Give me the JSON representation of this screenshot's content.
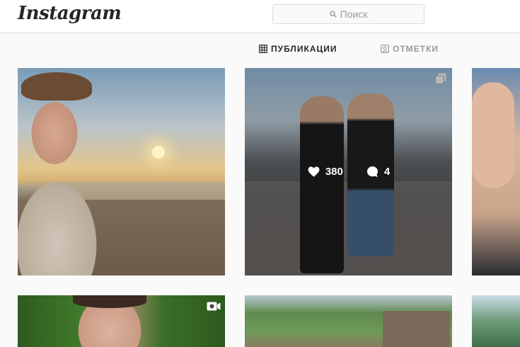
{
  "header": {
    "logo": "Instagram",
    "search_placeholder": "Поиск"
  },
  "tabs": [
    {
      "label": "ПУБЛИКАЦИИ",
      "active": true
    },
    {
      "label": "ОТМЕТКИ",
      "active": false
    }
  ],
  "posts": [
    {
      "row": 1,
      "col": 1,
      "type": "photo"
    },
    {
      "row": 1,
      "col": 2,
      "type": "multi",
      "likes": "380",
      "comments": "4",
      "hovered": true
    },
    {
      "row": 1,
      "col": 3,
      "type": "photo"
    },
    {
      "row": 2,
      "col": 1,
      "type": "video"
    },
    {
      "row": 2,
      "col": 2,
      "type": "photo"
    },
    {
      "row": 2,
      "col": 3,
      "type": "photo"
    }
  ],
  "colors": {
    "text_primary": "#262626",
    "text_secondary": "#999999",
    "border": "#dbdbdb",
    "background": "#fafafa"
  }
}
